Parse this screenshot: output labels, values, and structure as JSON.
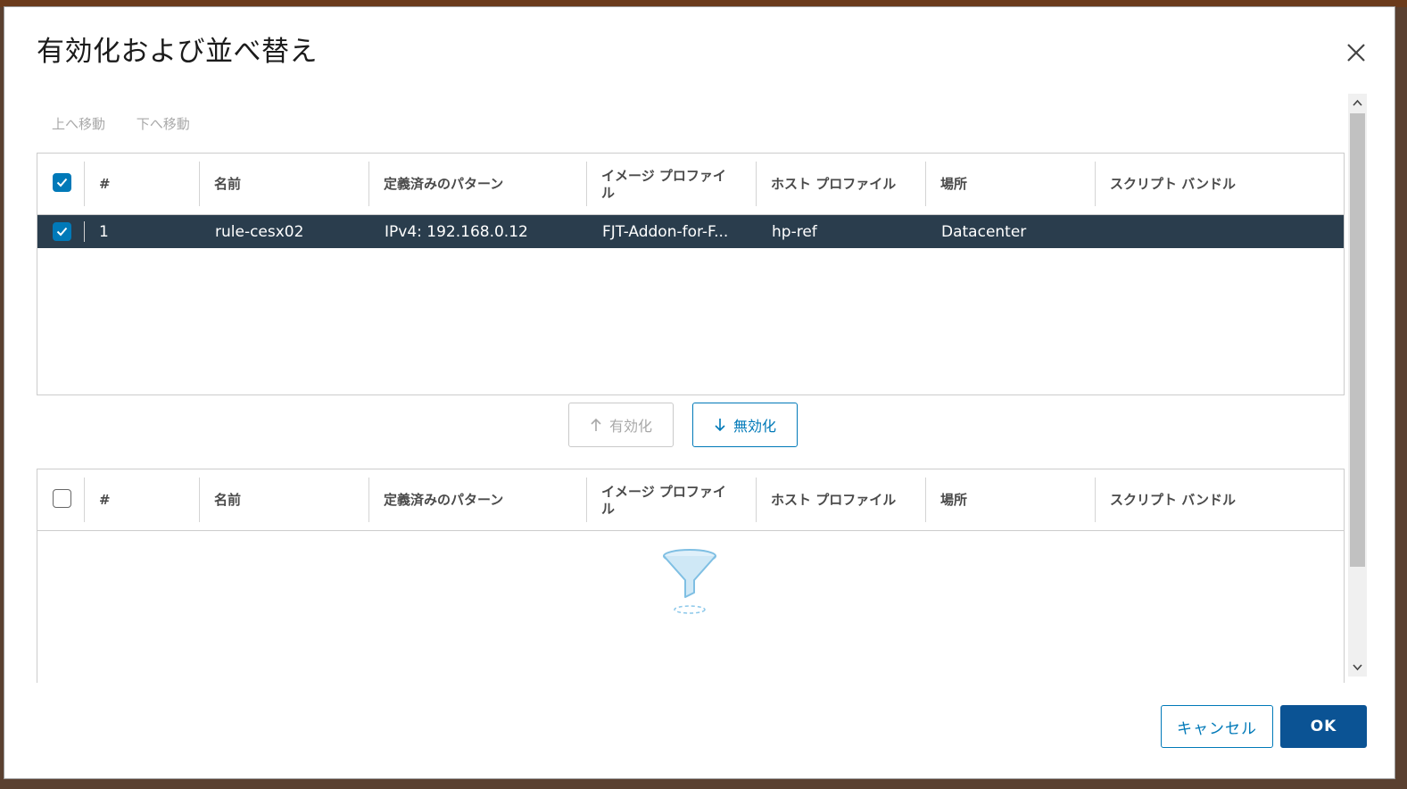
{
  "dialog": {
    "title": "有効化および並べ替え",
    "close_icon": "close-icon"
  },
  "toolbar": {
    "move_up": "上へ移動",
    "move_down": "下へ移動"
  },
  "columns": {
    "index": "#",
    "name": "名前",
    "pattern": "定義済みのパターン",
    "image_profile_line1": "イメージ プロファイ",
    "image_profile_line2": "ル",
    "host_profile": "ホスト プロファイル",
    "location": "場所",
    "script_bundle": "スクリプト バンドル"
  },
  "active_rules": {
    "select_all_checked": true,
    "rows": [
      {
        "checked": true,
        "index": "1",
        "name": "rule-cesx02",
        "pattern": "IPv4: 192.168.0.12",
        "image_profile": "FJT-Addon-for-F...",
        "host_profile": "hp-ref",
        "location": "Datacenter",
        "script_bundle": ""
      }
    ]
  },
  "move_buttons": {
    "enable_label": "有効化",
    "disable_label": "無効化",
    "enable_icon": "arrow-up-icon",
    "disable_icon": "arrow-down-icon"
  },
  "inactive_rules": {
    "select_all_checked": false,
    "rows": [],
    "empty_icon": "filter-funnel-icon"
  },
  "footer": {
    "cancel_label": "キャンセル",
    "ok_label": "OK"
  },
  "colors": {
    "accent": "#0079b8",
    "selected_row": "#2a3d4d",
    "primary_button": "#0b5394"
  }
}
